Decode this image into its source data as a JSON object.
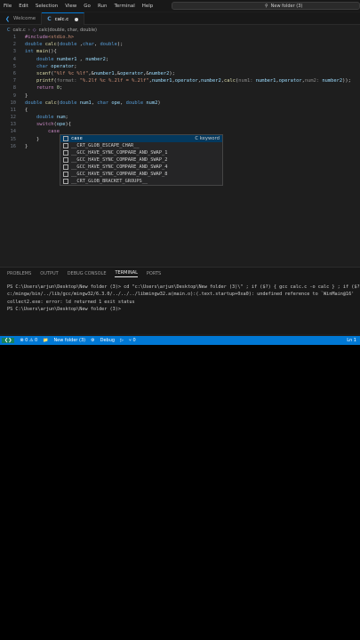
{
  "menubar": {
    "items": [
      "File",
      "Edit",
      "Selection",
      "View",
      "Go",
      "Run",
      "Terminal",
      "Help"
    ],
    "nav": "← →",
    "search": "New folder (3)"
  },
  "tabs": [
    {
      "label": "Welcome",
      "icon": "vscode-icon"
    },
    {
      "label": "calc.c",
      "icon": "c-file-icon"
    }
  ],
  "breadcrumb": {
    "file": "calc.c",
    "symbol": "calc(double, char, double)"
  },
  "editor": {
    "lines": [
      {
        "n": "1",
        "html": "<span class='pp'>#include</span><span class='str'>&lt;stdio.h&gt;</span>"
      },
      {
        "n": "2",
        "html": "<span class='kw'>double</span> <span class='fn'>calc</span>(<span class='kw'>double</span> ,<span class='kw'>char</span>, <span class='kw'>double</span>);"
      },
      {
        "n": "3",
        "html": "<span class='kw'>int</span> <span class='fn'>main</span>(){"
      },
      {
        "n": "4",
        "html": "    <span class='kw'>double</span> <span class='var'>number1</span> , <span class='var'>number2</span>;"
      },
      {
        "n": "5",
        "html": "    <span class='kw'>char</span> <span class='var'>operator</span>;"
      },
      {
        "n": "6",
        "html": "    <span class='fn'>scanf</span>(<span class='str'>\"%lf %c %lf\"</span>,&amp;<span class='var'>number1</span>,&amp;<span class='var'>operator</span>,&amp;<span class='var'>number2</span>);"
      },
      {
        "n": "7",
        "html": "    <span class='fn'>printf</span>(<span class='hint'>format: </span><span class='str'>\"%.2lf %c %.2lf = %.2lf\"</span>,<span class='var'>number1</span>,<span class='var'>operator</span>,<span class='var'>number2</span>,<span class='fn'>calc</span>(<span class='hint'>num1: </span><span class='var'>number1</span>,<span class='var'>operator</span>,<span class='hint'>num2: </span><span class='var'>number2</span>));"
      },
      {
        "n": "8",
        "html": "    <span class='ctl'>return</span> <span class='num'>0</span>;"
      },
      {
        "n": "9",
        "html": "}"
      },
      {
        "n": "10",
        "html": "<span class='kw'>double</span> <span class='fn'>calc</span>(<span class='kw'>double</span> <span class='var'>num1</span>, <span class='kw'>char</span> <span class='var'>ope</span>, <span class='kw'>double</span> <span class='var'>num2</span>)"
      },
      {
        "n": "11",
        "html": "{"
      },
      {
        "n": "12",
        "html": "    <span class='kw'>double</span> <span class='var'>num</span>;"
      },
      {
        "n": "13",
        "html": "    <span class='ctl'>switch</span>(<span class='var'>ope</span>){"
      },
      {
        "n": "14",
        "html": "        <span class='ctl'>case</span>"
      },
      {
        "n": "15",
        "html": "    }"
      },
      {
        "n": "16",
        "html": "}"
      }
    ]
  },
  "suggest": {
    "items": [
      {
        "label": "case",
        "detail": "C keyword"
      },
      {
        "label": "__CRT_GLOB_ESCAPE_CHAR__",
        "detail": ""
      },
      {
        "label": "__GCC_HAVE_SYNC_COMPARE_AND_SWAP_1",
        "detail": ""
      },
      {
        "label": "__GCC_HAVE_SYNC_COMPARE_AND_SWAP_2",
        "detail": ""
      },
      {
        "label": "__GCC_HAVE_SYNC_COMPARE_AND_SWAP_4",
        "detail": ""
      },
      {
        "label": "__GCC_HAVE_SYNC_COMPARE_AND_SWAP_8",
        "detail": ""
      },
      {
        "label": "__CRT_GLOB_BRACKET_GROUPS__",
        "detail": ""
      }
    ]
  },
  "panel": {
    "tabs": [
      "PROBLEMS",
      "OUTPUT",
      "DEBUG CONSOLE",
      "TERMINAL",
      "PORTS"
    ],
    "active": "TERMINAL",
    "terminal": [
      "PS C:\\Users\\arjun\\Desktop\\New folder (3)> cd \"c:\\Users\\arjun\\Desktop\\New folder (3)\\\" ; if ($?) { gcc calc.c -o calc } ; if ($?)",
      "c:/mingw/bin/../lib/gcc/mingw32/6.3.0/../../../libmingw32.a(main.o):(.text.startup+0xa0): undefined reference to `WinMain@16'",
      "collect2.exe: error: ld returned 1 exit status",
      "PS C:\\Users\\arjun\\Desktop\\New folder (3)> "
    ]
  },
  "statusbar": {
    "errors": "⊗ 0 ⚠ 0",
    "folder": "New folder (3)",
    "debug": "Debug",
    "ports": "⑂ 0",
    "position": "Ln 1"
  }
}
